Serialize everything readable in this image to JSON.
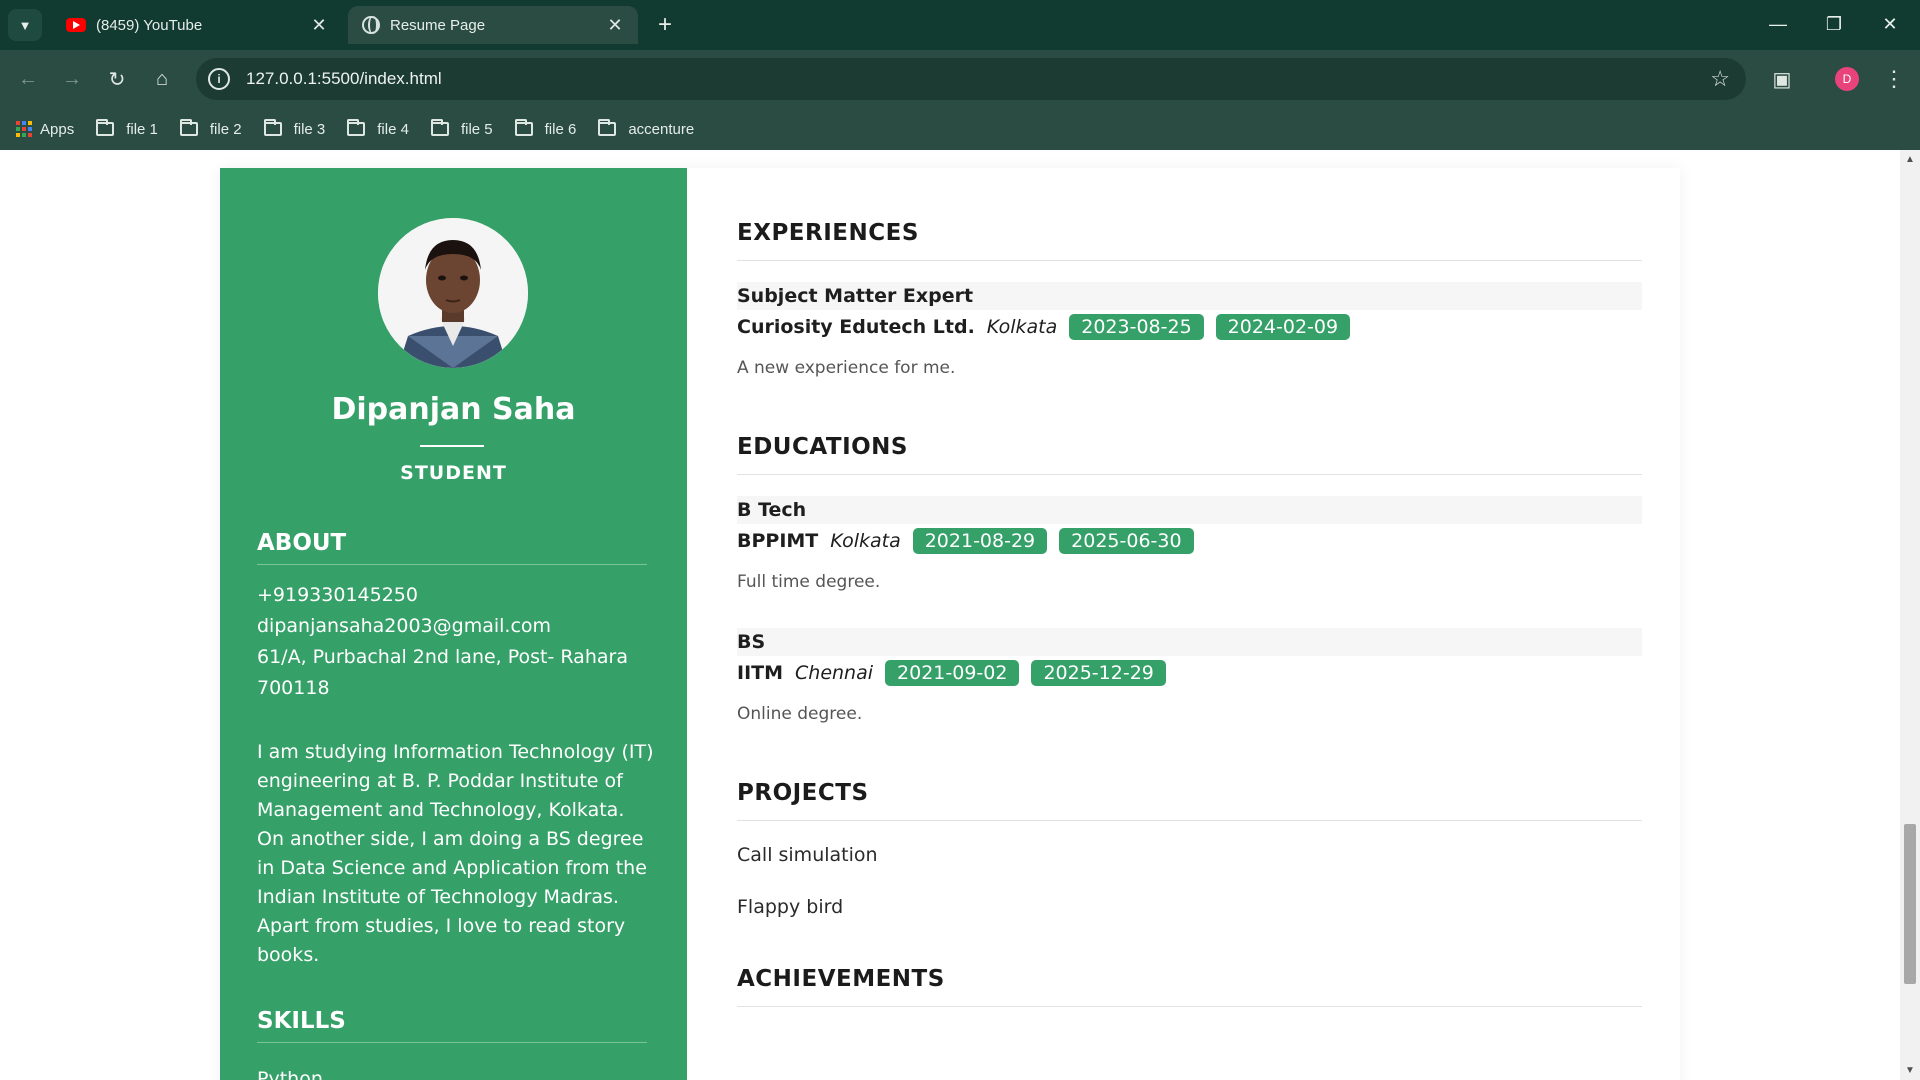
{
  "browser": {
    "tabs": [
      {
        "title": "(8459) YouTube",
        "active": false
      },
      {
        "title": "Resume Page",
        "active": true
      }
    ],
    "url": "127.0.0.1:5500/index.html",
    "profile_initial": "D",
    "bookmarks": {
      "apps_label": "Apps",
      "folders": [
        "file 1",
        "file 2",
        "file 3",
        "file 4",
        "file 5",
        "file 6",
        "accenture"
      ]
    }
  },
  "sidebar": {
    "name": "Dipanjan Saha",
    "role": "STUDENT",
    "about_heading": "ABOUT",
    "phone": "+919330145250",
    "email": "dipanjansaha2003@gmail.com",
    "address": "61/A, Purbachal 2nd lane, Post- Rahara 700118",
    "about_text": "I am studying Information Technology (IT) engineering at B. P. Poddar Institute of Management and Technology, Kolkata. On another side, I am doing a BS degree in Data Science and Application from the Indian Institute of Technology Madras. Apart from studies, I love to read story books.",
    "skills_heading": "SKILLS",
    "skills": [
      "Python"
    ]
  },
  "main": {
    "experiences_heading": "EXPERIENCES",
    "experiences": [
      {
        "title": "Subject Matter Expert",
        "org": "Curiosity Edutech Ltd.",
        "location": "Kolkata",
        "start": "2023-08-25",
        "end": "2024-02-09",
        "description": "A new experience for me."
      }
    ],
    "educations_heading": "EDUCATIONS",
    "educations": [
      {
        "title": "B Tech",
        "org": "BPPIMT",
        "location": "Kolkata",
        "start": "2021-08-29",
        "end": "2025-06-30",
        "description": "Full time degree."
      },
      {
        "title": "BS",
        "org": "IITM",
        "location": "Chennai",
        "start": "2021-09-02",
        "end": "2025-12-29",
        "description": "Online degree."
      }
    ],
    "projects_heading": "PROJECTS",
    "projects": [
      "Call simulation",
      "Flappy bird"
    ],
    "achievements_heading": "ACHIEVEMENTS"
  },
  "colors": {
    "accent_green": "#35a068",
    "chrome_dark": "#113a30",
    "chrome_toolbar": "#2a4c43"
  }
}
